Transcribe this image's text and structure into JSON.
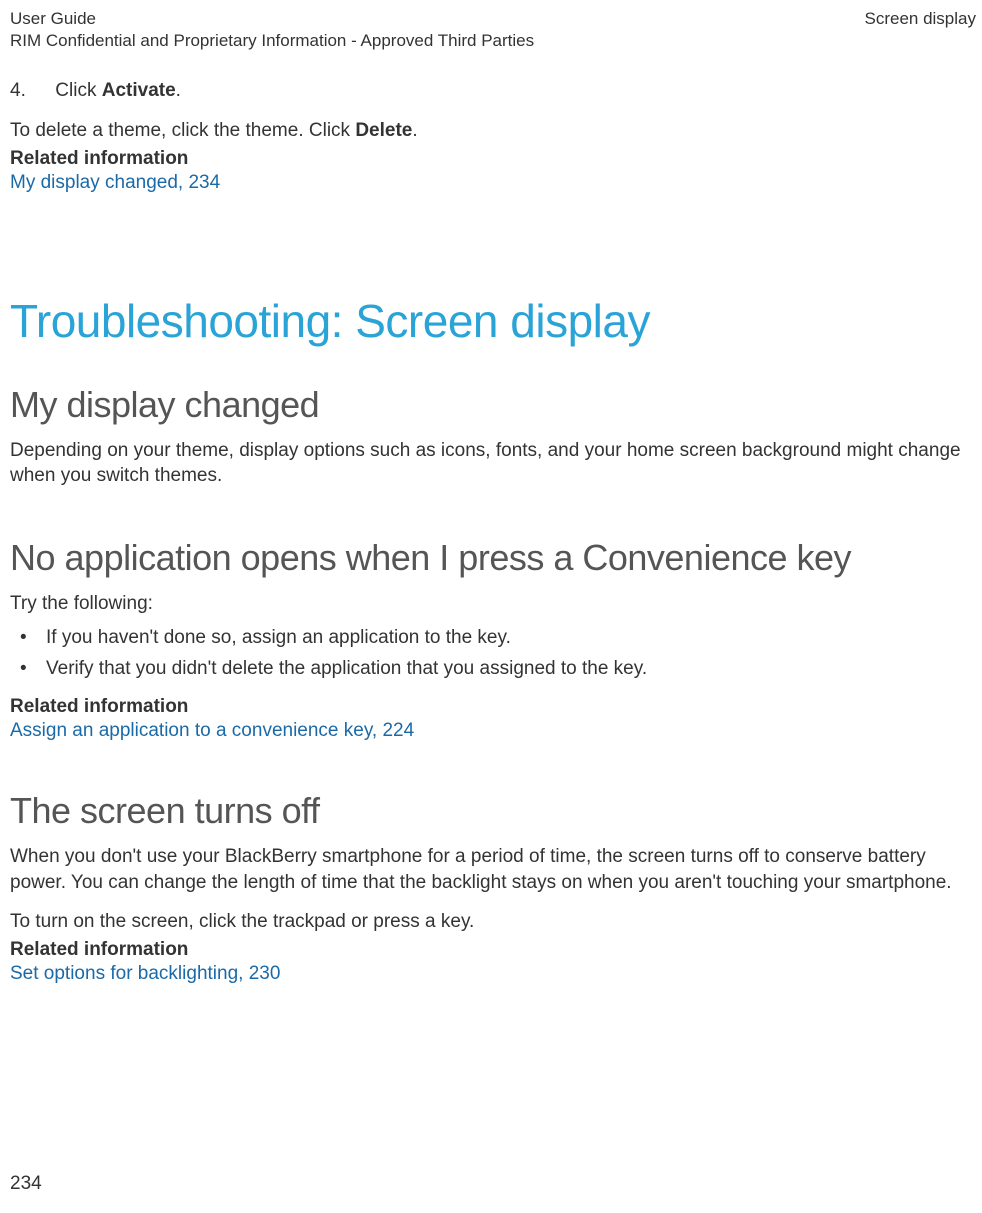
{
  "header": {
    "left_line1": "User Guide",
    "left_line2": "RIM Confidential and Proprietary Information - Approved Third Parties",
    "right": "Screen display"
  },
  "intro": {
    "step_number": "4.",
    "step_prefix": "Click ",
    "step_bold": "Activate",
    "step_suffix": ".",
    "delete_prefix": "To delete a theme, click the theme. Click ",
    "delete_bold": "Delete",
    "delete_suffix": ".",
    "related_label": "Related information",
    "related_link": "My display changed, 234"
  },
  "main_heading": "Troubleshooting: Screen display",
  "section1": {
    "heading": "My display changed",
    "body": "Depending on your theme, display options such as icons, fonts, and your home screen background might change when you switch themes."
  },
  "section2": {
    "heading": "No application opens when I press a Convenience key",
    "intro": "Try the following:",
    "bullets": [
      "If you haven't done so, assign an application to the key.",
      "Verify that you didn't delete the application that you assigned to the key."
    ],
    "related_label": "Related information",
    "related_link": "Assign an application to a convenience key, 224"
  },
  "section3": {
    "heading": "The screen turns off",
    "body1": "When you don't use your BlackBerry smartphone for a period of time, the screen turns off to conserve battery power. You can change the length of time that the backlight stays on when you aren't touching your smartphone.",
    "body2": "To turn on the screen, click the trackpad or press a key.",
    "related_label": "Related information",
    "related_link": "Set options for backlighting, 230"
  },
  "page_number": "234"
}
